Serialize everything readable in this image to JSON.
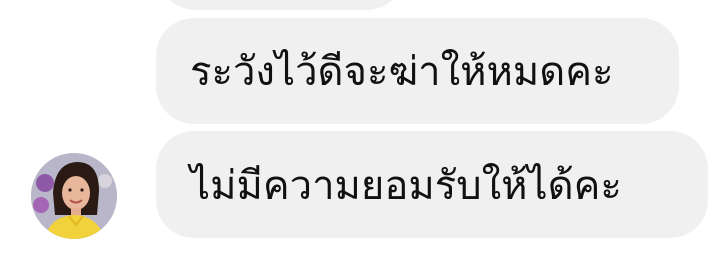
{
  "chat": {
    "messages": [
      {
        "text": ""
      },
      {
        "text": "ระวังไว้ดีจะฆ่าให้หมดคะ"
      },
      {
        "text": "ไม่มีความยอมรับให้ได้คะ"
      }
    ],
    "sender": {
      "avatar_icon": "user-avatar"
    }
  },
  "colors": {
    "bubble_bg": "#f0f0f0",
    "text": "#111111",
    "page_bg": "#ffffff"
  }
}
